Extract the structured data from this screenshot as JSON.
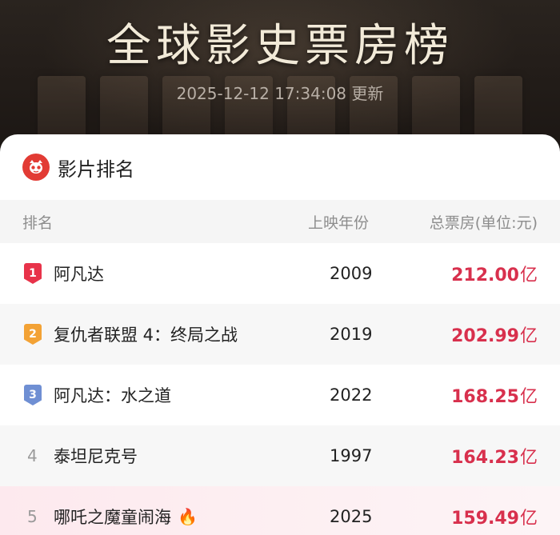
{
  "header": {
    "title": "全球影史票房榜",
    "updated": "2025-12-12 17:34:08 更新"
  },
  "card": {
    "title": "影片排名",
    "logo_icon": "cat-eye-logo"
  },
  "columns": {
    "rank": "排名",
    "year": "上映年份",
    "gross": "总票房(单位:元)"
  },
  "colors": {
    "accent": "#d8304d",
    "rank1": "#e8334a",
    "rank2": "#f3a235",
    "rank3": "#6f8fd3"
  },
  "rows": [
    {
      "rank": "1",
      "name": "阿凡达",
      "year": "2009",
      "gross": "212.00",
      "unit": "亿"
    },
    {
      "rank": "2",
      "name": "复仇者联盟 4：终局之战",
      "year": "2019",
      "gross": "202.99",
      "unit": "亿"
    },
    {
      "rank": "3",
      "name": "阿凡达：水之道",
      "year": "2022",
      "gross": "168.25",
      "unit": "亿"
    },
    {
      "rank": "4",
      "name": "泰坦尼克号",
      "year": "1997",
      "gross": "164.23",
      "unit": "亿"
    },
    {
      "rank": "5",
      "name": "哪吒之魔童闹海",
      "year": "2025",
      "gross": "159.49",
      "unit": "亿",
      "hot_icon": "fire-icon"
    }
  ]
}
